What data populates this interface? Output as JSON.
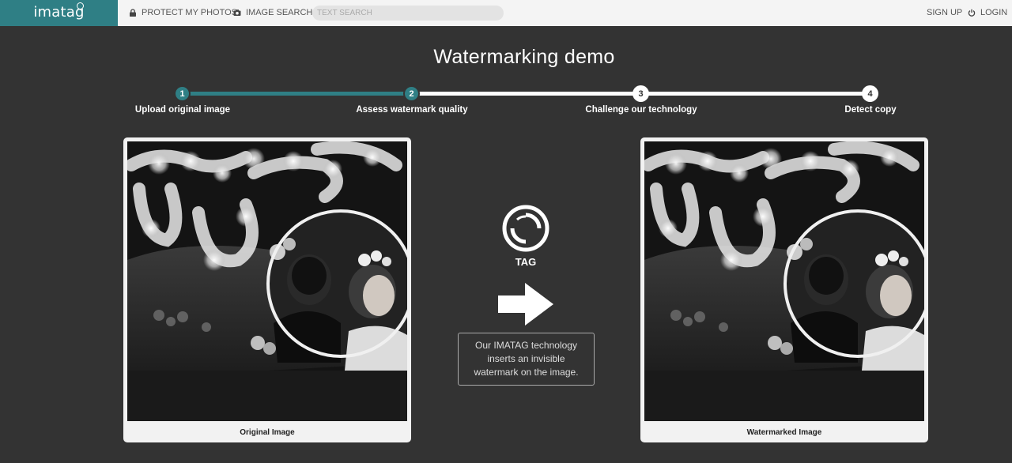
{
  "header": {
    "logo_text": "imatag",
    "nav": {
      "protect": "PROTECT MY PHOTOS",
      "image_search": "IMAGE SEARCH",
      "signup": "SIGN UP",
      "login": "LOGIN"
    },
    "search": {
      "placeholder": "TEXT SEARCH",
      "value": ""
    }
  },
  "page": {
    "title": "Watermarking demo"
  },
  "steps": [
    {
      "number": "1",
      "label": "Upload original image",
      "state": "done"
    },
    {
      "number": "2",
      "label": "Assess watermark quality",
      "state": "done"
    },
    {
      "number": "3",
      "label": "Challenge our technology",
      "state": "todo"
    },
    {
      "number": "4",
      "label": "Detect copy",
      "state": "todo"
    }
  ],
  "cards": {
    "original": {
      "caption": "Original Image"
    },
    "watermarked": {
      "caption": "Watermarked Image"
    }
  },
  "center": {
    "tag_label": "TAG",
    "description": "Our IMATAG technology inserts an invisible watermark on the image."
  },
  "colors": {
    "accent": "#2f7f85",
    "background": "#333333",
    "topbar": "#f4f4f4"
  },
  "icons": {
    "lock": "lock-icon",
    "camera": "camera-icon",
    "power": "power-icon",
    "tag": "tag-logo-icon",
    "arrow": "arrow-right-icon"
  }
}
